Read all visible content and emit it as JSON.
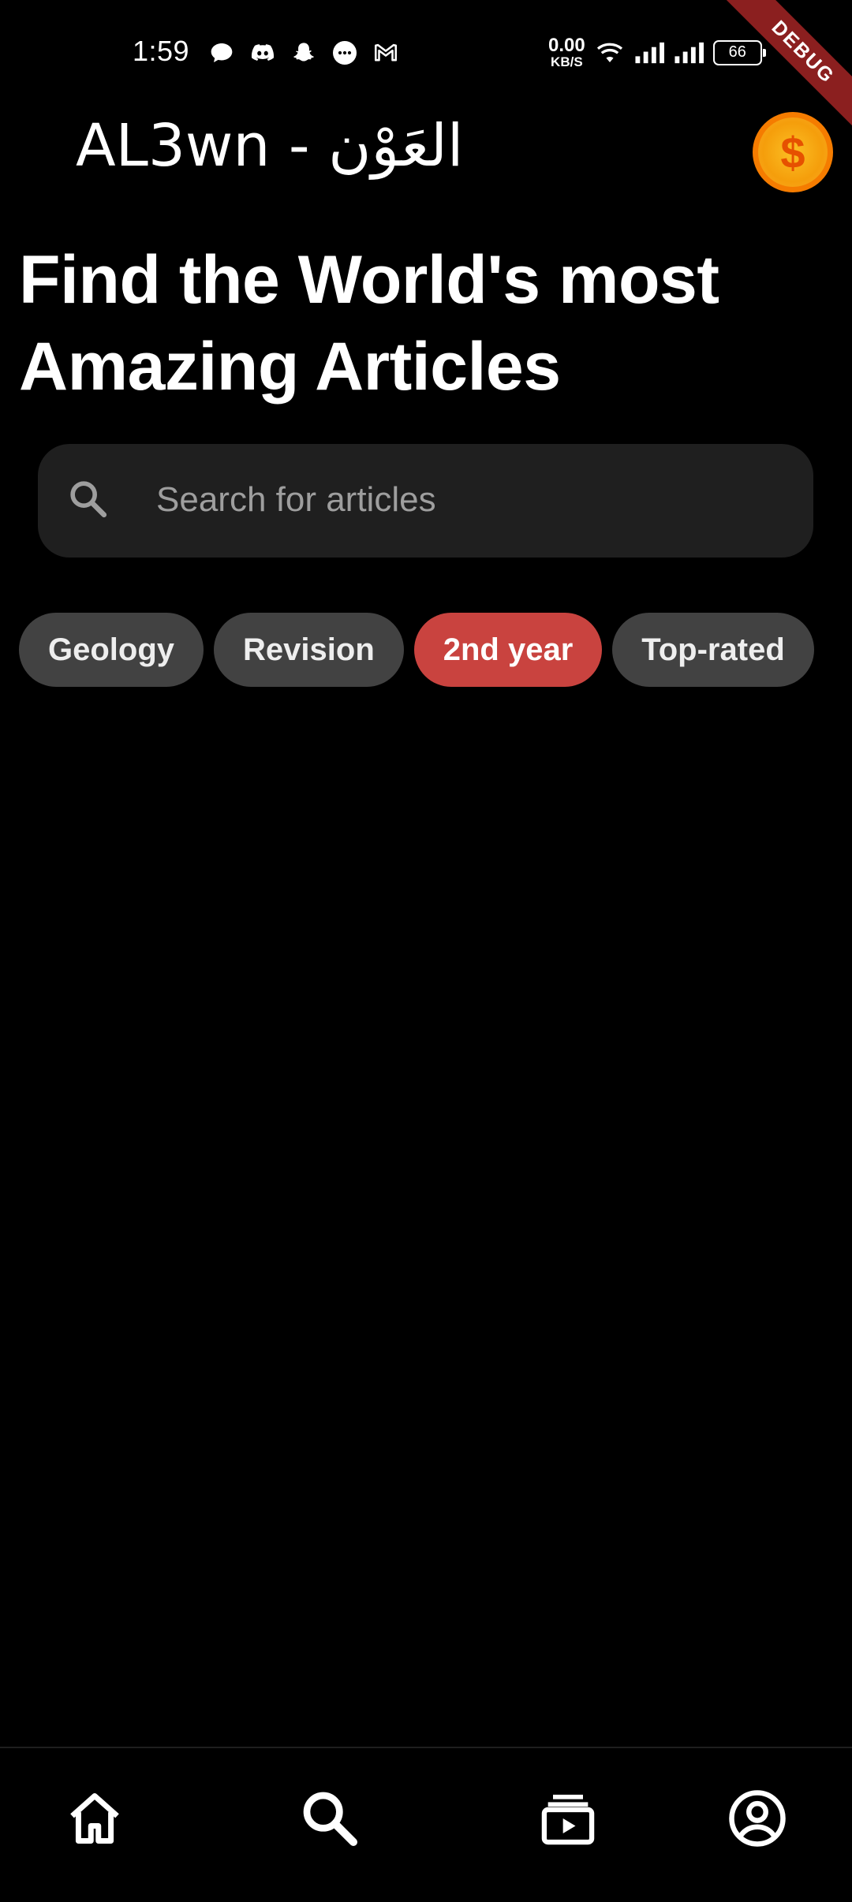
{
  "status_bar": {
    "time": "1:59",
    "net_speed_value": "0.00",
    "net_speed_unit": "KB/S",
    "battery": "66",
    "notification_icons": [
      "chat-icon",
      "discord-icon",
      "snapchat-icon",
      "messenger-icon",
      "gmail-icon"
    ]
  },
  "debug_banner": "DEBUG",
  "app_bar": {
    "title": "AL3wn - العَوْن",
    "coin_symbol": "$"
  },
  "headline": "Find the World's most Amazing Articles",
  "search": {
    "placeholder": "Search for articles"
  },
  "filters": [
    {
      "label": "Geology",
      "selected": false
    },
    {
      "label": "Revision",
      "selected": false
    },
    {
      "label": "2nd year",
      "selected": true
    },
    {
      "label": "Top-rated",
      "selected": false
    }
  ],
  "bottom_nav": [
    "home-icon",
    "search-icon",
    "subscriptions-icon",
    "account-icon"
  ],
  "colors": {
    "background": "#000000",
    "chip": "#424242",
    "chip_selected": "#c9433f",
    "search_bg": "#1f1f1f",
    "coin": "#fbbf24"
  }
}
